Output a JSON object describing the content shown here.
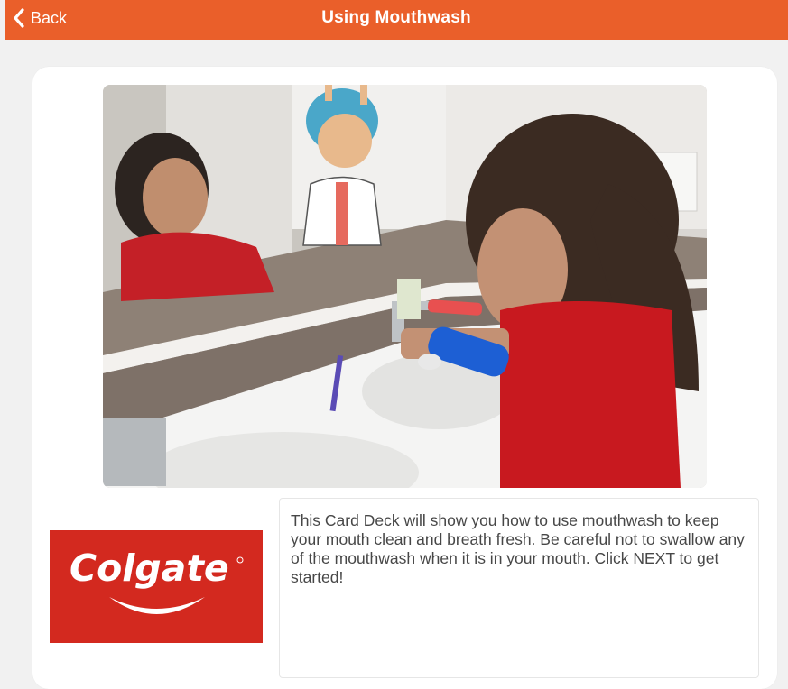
{
  "header": {
    "back_label": "Back",
    "back_icon": "chevron-left-icon",
    "title": "Using Mouthwash",
    "color": "#ea5f2a"
  },
  "card": {
    "image_subject": "girl-pouring-mouthwash-at-sink",
    "logo": {
      "text": "Colgate",
      "color": "#d3291f"
    },
    "description": "This Card Deck will show you how to use mouthwash to keep your mouth clean and breath fresh. Be careful not to swallow any of the mouthwash when it is in your mouth. Click NEXT to get started!"
  }
}
